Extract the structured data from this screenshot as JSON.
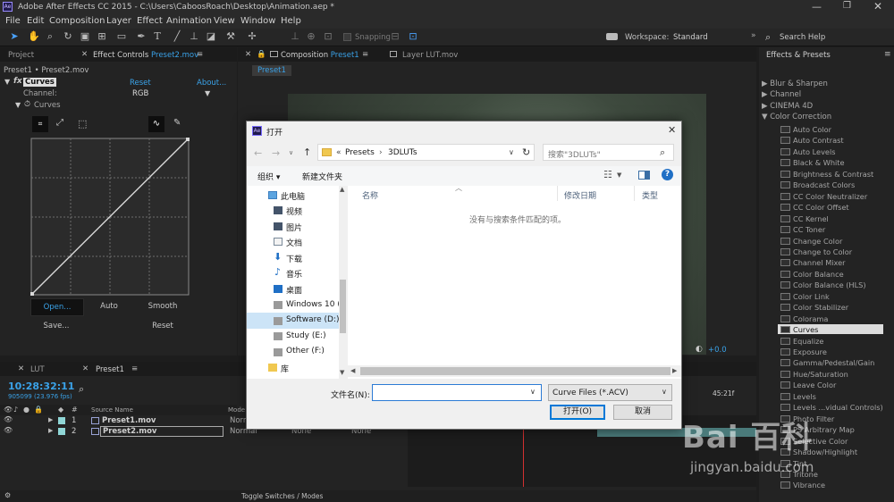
{
  "window": {
    "title": "Adobe After Effects CC 2015 - C:\\Users\\CaboosRoach\\Desktop\\Animation.aep *"
  },
  "menu": [
    "File",
    "Edit",
    "Composition",
    "Layer",
    "Effect",
    "Animation",
    "View",
    "Window",
    "Help"
  ],
  "toolbar": {
    "snapping": "Snapping",
    "workspace_label": "Workspace:",
    "workspace_value": "Standard",
    "search_help": "Search Help"
  },
  "project_panel": {
    "tab_project": "Project",
    "tab_effect_controls": "Effect Controls",
    "tab_effect_controls_target": "Preset2.mov",
    "breadcrumb": "Preset1 • Preset2.mov",
    "effect_name": "Curves",
    "reset": "Reset",
    "about": "About...",
    "channel_label": "Channel:",
    "channel_value": "RGB",
    "curves_label": "Curves",
    "buttons": {
      "open": "Open...",
      "auto": "Auto",
      "smooth": "Smooth",
      "save": "Save...",
      "reset": "Reset"
    }
  },
  "composition_panel": {
    "tab_composition": "Composition",
    "tab_composition_target": "Preset1",
    "tab_layer": "Layer LUT.mov",
    "subtab": "Preset1",
    "zoom_offset": "+0.0"
  },
  "timeline": {
    "tab_lut": "LUT",
    "tab_preset1": "Preset1",
    "timecode": "10:28:32:11",
    "frame_info": "905099 (23.976 fps)",
    "col_source_name": "Source Name",
    "col_mode": "Mode",
    "layers": [
      {
        "num": "1",
        "name": "Preset1.mov",
        "mode": "Norm"
      },
      {
        "num": "2",
        "name": "Preset2.mov",
        "mode": "Normal",
        "trkmat": "None",
        "parent": "None"
      }
    ],
    "time_marker": "45:21f",
    "footer": "Toggle Switches / Modes"
  },
  "effects_presets": {
    "title": "Effects & Presets",
    "folders": [
      "Blur & Sharpen",
      "Channel",
      "CINEMA 4D",
      "Color Correction"
    ],
    "items": [
      "Auto Color",
      "Auto Contrast",
      "Auto Levels",
      "Black & White",
      "Brightness & Contrast",
      "Broadcast Colors",
      "CC Color Neutralizer",
      "CC Color Offset",
      "CC Kernel",
      "CC Toner",
      "Change Color",
      "Change to Color",
      "Channel Mixer",
      "Color Balance",
      "Color Balance (HLS)",
      "Color Link",
      "Color Stabilizer",
      "Colorama",
      "Curves",
      "Equalize",
      "Exposure",
      "Gamma/Pedestal/Gain",
      "Hue/Saturation",
      "Leave Color",
      "Levels",
      "Levels ...vidual Controls)",
      "Photo Filter",
      "PS Arbitrary Map",
      "Selective Color",
      "Shadow/Highlight",
      "Tint",
      "Tritone",
      "Vibrance"
    ],
    "selected": "Curves"
  },
  "dialog": {
    "title": "打开",
    "path": [
      "«",
      "Presets",
      "3DLUTs"
    ],
    "search_placeholder": "搜索\"3DLUTs\"",
    "organize": "组织 ▾",
    "new_folder": "新建文件夹",
    "nav": [
      "此电脑",
      "视频",
      "图片",
      "文档",
      "下载",
      "音乐",
      "桌面",
      "Windows 10 (",
      "Software (D:)",
      "Study (E:)",
      "Other (F:)",
      "库"
    ],
    "columns": [
      "名称",
      "修改日期",
      "类型"
    ],
    "empty_message": "没有与搜索条件匹配的项。",
    "filename_label": "文件名(N):",
    "filename_value": "",
    "filetype": "Curve Files (*.ACV)",
    "open_button": "打开(O)",
    "cancel_button": "取消"
  },
  "watermark": {
    "brand": "Bai 百科",
    "url": "jingyan.baidu.com"
  }
}
